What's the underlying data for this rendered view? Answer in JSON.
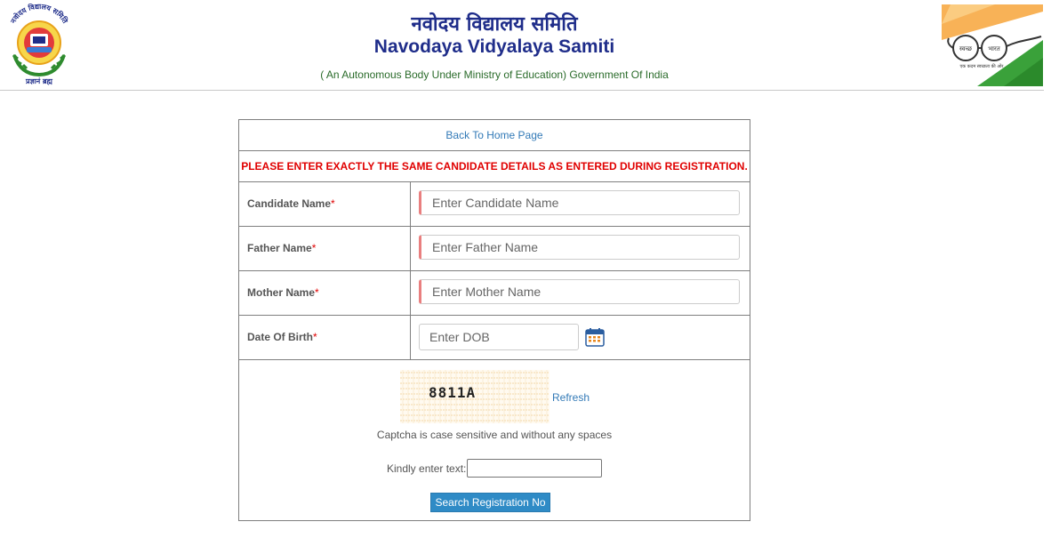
{
  "header": {
    "title_hindi": "नवोदय विद्यालय समिति",
    "title_english": "Navodaya Vidyalaya Samiti",
    "subtitle": "( An Autonomous Body Under Ministry of Education) Government Of India",
    "left_logo_icon": "nvs-emblem-logo",
    "right_logo_icon": "swachh-bharat-logo",
    "left_logo_arc_text": "नवोदय विद्यालय समिति",
    "left_logo_motto": "प्रज्ञानं ब्रह्म",
    "right_logo_word_left": "स्वच्छ",
    "right_logo_word_right": "भारत",
    "right_logo_tagline": "एक कदम स्वच्छता की ओर"
  },
  "form": {
    "back_link": "Back To Home Page",
    "warning": "PLEASE ENTER EXACTLY THE SAME CANDIDATE DETAILS AS ENTERED DURING REGISTRATION.",
    "required_mark": "*",
    "fields": {
      "candidate_name": {
        "label": "Candidate Name",
        "placeholder": "Enter Candidate Name",
        "value": ""
      },
      "father_name": {
        "label": "Father Name",
        "placeholder": "Enter Father Name",
        "value": ""
      },
      "mother_name": {
        "label": "Mother Name",
        "placeholder": "Enter Mother Name",
        "value": ""
      },
      "dob": {
        "label": "Date Of Birth",
        "placeholder": "Enter DOB",
        "value": "",
        "icon": "calendar-icon"
      }
    },
    "captcha": {
      "code": "8811A",
      "refresh_label": "Refresh",
      "note": "Captcha is case sensitive and without any spaces",
      "prompt": "Kindly enter text:",
      "value": ""
    },
    "submit_label": "Search Registration No"
  },
  "colors": {
    "title": "#1f2d8a",
    "subtitle": "#2a6b2a",
    "warning": "#e00000",
    "link": "#337ab7",
    "button": "#2f8bc6",
    "input_accent": "#e97f7f"
  }
}
